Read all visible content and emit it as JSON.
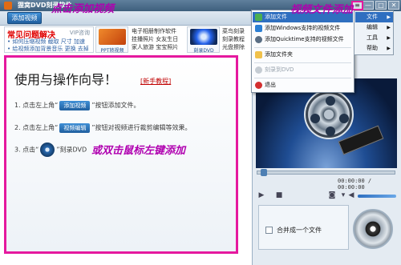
{
  "window": {
    "title": "狸窝DVD刻录软件",
    "buttons": [
      "—",
      "□",
      "✕"
    ]
  },
  "toolbar": {
    "add_video": "添加视频"
  },
  "annotations": {
    "add_video_hint": "点击添加视频",
    "menu_hint": "视频文件添加",
    "double_click_hint": "或双击鼠标左键添加"
  },
  "faq": {
    "title": "常见问题解决",
    "vip": "VIP咨询",
    "line1": "• 如何压缩视频  截取  尺寸  加速",
    "line2": "• 给视频添加背景音乐  更换  去掉"
  },
  "promos": [
    {
      "caption": "PPT转视频"
    },
    {
      "caption": "刻录DVD"
    }
  ],
  "menu_links": {
    "col1": [
      "电子相册制作软件",
      "挂播照片  女友生日",
      "家人旅游  宝宝照片"
    ],
    "col2": [
      "菜鸟刻录",
      "刻录教程",
      "光盘擦除"
    ]
  },
  "guide": {
    "title": "使用与操作向导！",
    "help_link": "[新手教程]",
    "step1_prefix": "1. 点击左上角“",
    "step1_tag": "添加视频",
    "step1_suffix": "”按钮添加文件。",
    "step2_prefix": "2. 点击左上角“",
    "step2_tag": "视频编辑",
    "step2_suffix": "”按钮对视频进行裁剪编辑等效果。",
    "step3_prefix": "3. 点击“",
    "step3_suffix": "”刻录DVD"
  },
  "player": {
    "time": "00:00:00 / 00:00:00",
    "merge_label": "合并成一个文件"
  },
  "context_menu": {
    "items": [
      {
        "label": "添加文件",
        "active": true
      },
      {
        "label": "添加Windows支持的视频文件"
      },
      {
        "label": "添加Quicktime支持的视频文件"
      },
      {
        "label": "添加文件夹"
      },
      {
        "label": "刻录到DVD",
        "disabled": true
      },
      {
        "label": "退出"
      }
    ]
  },
  "main_menu": {
    "items": [
      {
        "label": "文件",
        "active": true
      },
      {
        "label": "编辑"
      },
      {
        "label": "工具"
      },
      {
        "label": "帮助"
      }
    ]
  },
  "colors": {
    "accent": "#2f6fc0",
    "annotation": "#b000b0",
    "highlight_border": "#e5199e",
    "faq_red": "#e00000"
  }
}
